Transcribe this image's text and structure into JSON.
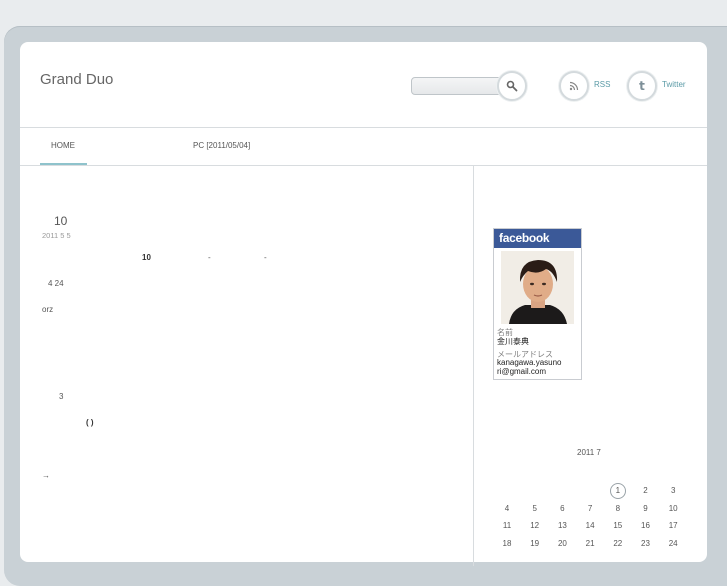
{
  "header": {
    "site_title": "Grand Duo",
    "search_placeholder": "",
    "rss_label": "RSS",
    "twitter_label": "Twitter"
  },
  "nav": {
    "home": "HOME",
    "latest": "PC  [2011/05/04]"
  },
  "post": {
    "title": "10",
    "date": "2011  5 5",
    "lines": [
      "10",
      "-",
      "-",
      "4 24",
      "orz",
      "3",
      "( )",
      "→"
    ]
  },
  "profile": {
    "badge_label": "facebook",
    "name_label": "名前",
    "name_value": "金川泰典",
    "email_label": "メールアドレス",
    "email_line1": "kanagawa.yasuno",
    "email_line2": "ri@gmail.com"
  },
  "calendar": {
    "title": "2011 7",
    "today": "1",
    "rows": [
      [
        "",
        "",
        "",
        "",
        "1",
        "2",
        "3"
      ],
      [
        "4",
        "5",
        "6",
        "7",
        "8",
        "9",
        "10"
      ],
      [
        "11",
        "12",
        "13",
        "14",
        "15",
        "16",
        "17"
      ],
      [
        "18",
        "19",
        "20",
        "21",
        "22",
        "23",
        "24"
      ]
    ]
  }
}
